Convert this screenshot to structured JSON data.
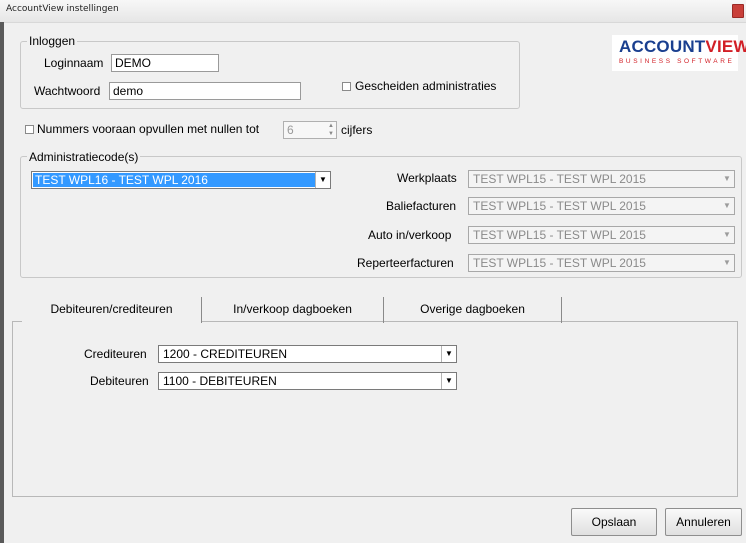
{
  "window": {
    "title": "AccountView instellingen"
  },
  "logo": {
    "text_part1": "ACCOUNT",
    "text_part2": "VIEW",
    "sub": "BUSINESS SOFTWARE",
    "mark": "®"
  },
  "login": {
    "legend": "Inloggen",
    "username_label": "Loginnaam",
    "username_value": "DEMO",
    "password_label": "Wachtwoord",
    "password_value": "demo",
    "separate_admin_label": "Gescheiden administraties",
    "separate_admin_checked": false
  },
  "zero_pad": {
    "label": "Nummers vooraan opvullen met nullen tot",
    "value": "6",
    "suffix": "cijfers",
    "checked": false
  },
  "admin": {
    "legend": "Administratiecode(s)",
    "selected": "TEST WPL16 - TEST WPL 2016",
    "fields": [
      {
        "label": "Werkplaats",
        "value": "TEST WPL15 - TEST WPL 2015"
      },
      {
        "label": "Baliefacturen",
        "value": "TEST WPL15 - TEST WPL 2015"
      },
      {
        "label": "Auto in/verkoop",
        "value": "TEST WPL15 - TEST WPL 2015"
      },
      {
        "label": "Reperteerfacturen",
        "value": "TEST WPL15 - TEST WPL 2015"
      }
    ]
  },
  "tabs": [
    {
      "label": "Debiteuren/crediteuren",
      "active": true
    },
    {
      "label": "In/verkoop dagboeken",
      "active": false
    },
    {
      "label": "Overige dagboeken",
      "active": false
    }
  ],
  "accounts": {
    "crediteuren_label": "Crediteuren",
    "crediteuren_value": "1200 - CREDITEUREN",
    "debiteuren_label": "Debiteuren",
    "debiteuren_value": "1100 - DEBITEUREN"
  },
  "buttons": {
    "save": "Opslaan",
    "cancel": "Annuleren"
  },
  "colors": {
    "selection": "#3399ff",
    "logo_blue": "#1a3f8f",
    "logo_red": "#d21f26"
  }
}
